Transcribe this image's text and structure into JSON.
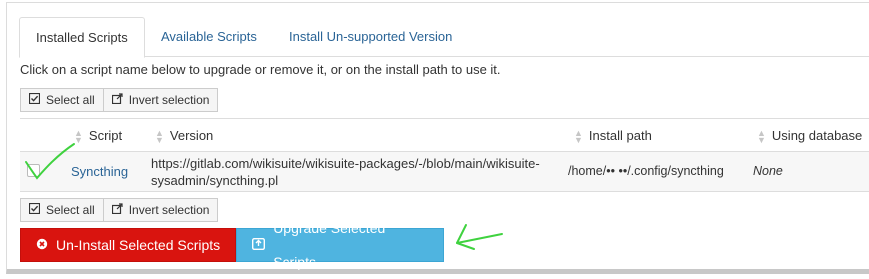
{
  "tabs": [
    {
      "label": "Installed Scripts"
    },
    {
      "label": "Available Scripts"
    },
    {
      "label": "Install Un-supported Version"
    }
  ],
  "instructions": "Click on a script name below to upgrade or remove it, or on the install path to use it.",
  "selection_buttons": {
    "select_all": "Select all",
    "invert": "Invert selection"
  },
  "table": {
    "headers": {
      "script": "Script",
      "version": "Version",
      "install_path": "Install path",
      "using_database": "Using database"
    },
    "rows": [
      {
        "script": "Syncthing",
        "version_line1": "https://gitlab.com/wikisuite/wikisuite-packages/-/blob/main/wikisuite-",
        "version_line2": "sysadmin/syncthing.pl",
        "install_path": "/home/•• ••/.config/syncthing",
        "using_database": "None"
      }
    ]
  },
  "actions": {
    "uninstall": "Un-Install Selected Scripts",
    "upgrade": "Upgrade Selected Scripts"
  },
  "colors": {
    "link": "#2a6496",
    "danger": "#d9140f",
    "info": "#4fb4e0",
    "annotation": "#3fd23f"
  },
  "icons": {
    "select_all": "check-square-icon",
    "invert": "invert-icon",
    "uninstall": "times-circle-icon",
    "upgrade": "upgrade-box-icon"
  }
}
